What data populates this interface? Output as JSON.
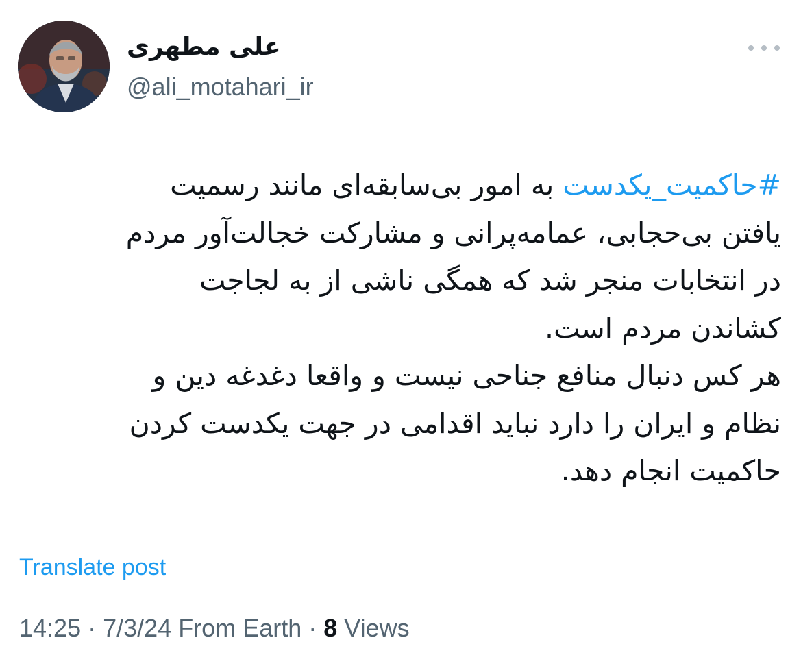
{
  "author": {
    "display_name": "علی مطهری",
    "handle": "@ali_motahari_ir",
    "avatar_icon": "profile-photo"
  },
  "tweet": {
    "hashtag": "#حاکمیت_یکدست",
    "lines": [
      " به امور بی‌سابقه‌ای مانند رسمیت",
      "یافتن بی‌حجابی، عمامه‌پرانی و مشارکت خجالت‌آور مردم",
      "در انتخابات منجر شد که همگی ناشی از به لجاجت",
      "کشاندن مردم است.",
      "هر کس دنبال منافع جناحی نیست و واقعا دغدغه دین و",
      "نظام و ایران را دارد نباید اقدامی در جهت یکدست کردن",
      "حاکمیت انجام دهد."
    ]
  },
  "translate_label": "Translate post",
  "meta": {
    "time": "14:25",
    "separator": " · ",
    "date": "7/3/24",
    "source": "From Earth",
    "views_count": "8",
    "views_label": "Views"
  },
  "colors": {
    "accent": "#1d9bf0",
    "text": "#0f1419",
    "secondary": "#536471"
  },
  "icons": {
    "more": "more-horizontal-icon"
  }
}
